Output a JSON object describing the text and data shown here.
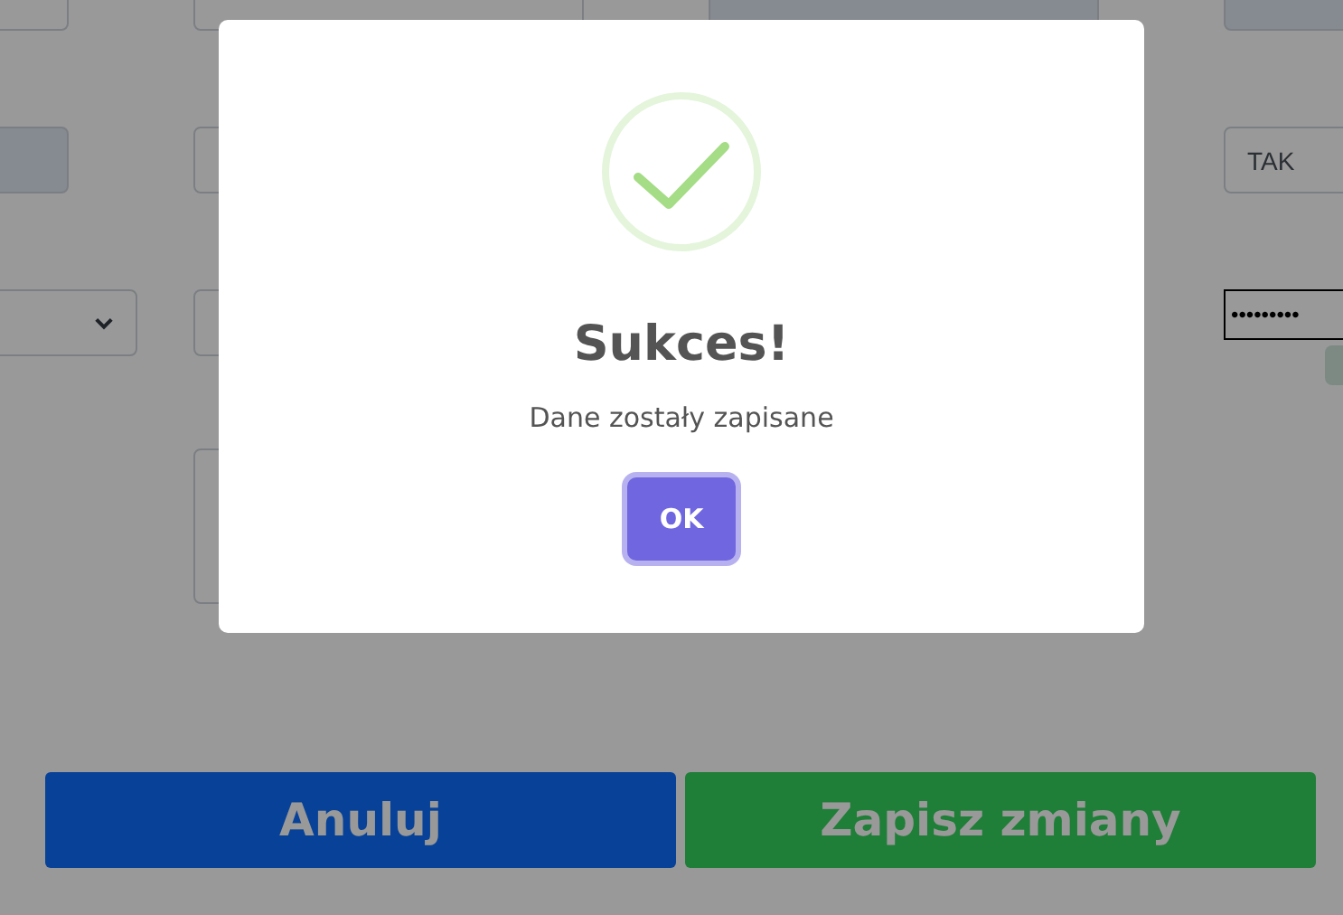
{
  "form": {
    "rows": [
      {
        "cells": [
          {
            "field": {
              "kind": "text",
              "disabled": false
            }
          },
          {
            "field": {
              "kind": "text",
              "disabled": false
            }
          },
          {
            "field": {
              "kind": "text",
              "disabled": true
            }
          },
          {
            "field": {
              "kind": "text",
              "disabled": true
            }
          }
        ]
      },
      {
        "cells": [
          {
            "field": {
              "kind": "text",
              "disabled": true
            }
          },
          {
            "field": {
              "kind": "text",
              "disabled": false
            }
          },
          {},
          {
            "field": {
              "kind": "text",
              "disabled": false,
              "value": "TAK"
            }
          }
        ]
      },
      {
        "cells": [
          {
            "field": {
              "kind": "select",
              "disabled": false
            }
          },
          {
            "field": {
              "kind": "text",
              "disabled": false
            }
          },
          {},
          {
            "field": {
              "kind": "password",
              "disabled": false,
              "value": "•••••••••"
            },
            "badge": true
          }
        ]
      },
      {
        "cells": [
          {},
          {
            "field": {
              "kind": "textarea",
              "disabled": false
            }
          }
        ]
      }
    ]
  },
  "buttons": [
    {
      "kind": "cancel",
      "label": "Anuluj"
    },
    {
      "kind": "save",
      "label": "Zapisz zmiany"
    }
  ],
  "dialog": {
    "kind": "success",
    "title": "Sukces!",
    "message": "Dane zostały zapisane",
    "confirm_button": "OK"
  }
}
